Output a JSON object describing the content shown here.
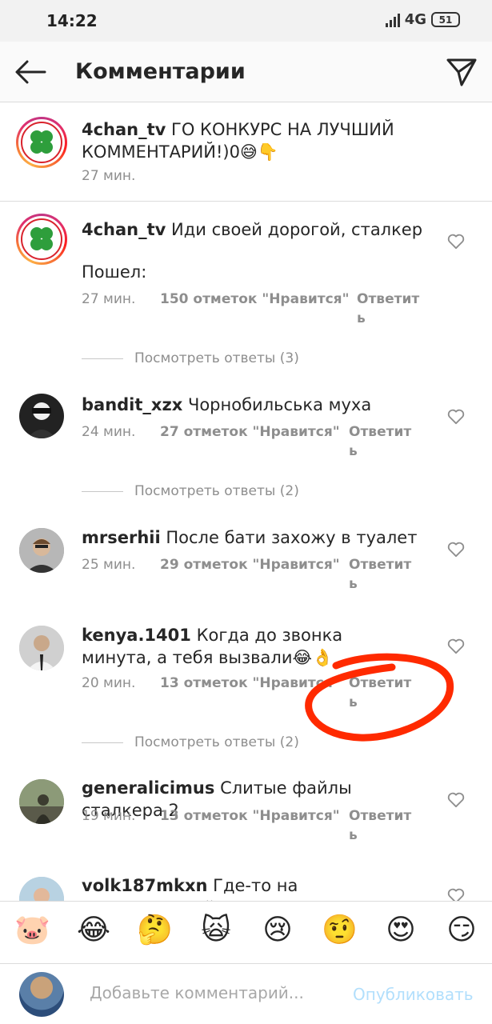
{
  "status_bar": {
    "time": "14:22",
    "network": "4G",
    "battery": "51"
  },
  "header": {
    "title": "Комментарии",
    "back_icon": "arrow-left-icon",
    "send_icon": "paper-plane-icon"
  },
  "caption": {
    "username": "4chan_tv",
    "text": "ГО КОНКУРС НА ЛУЧШИЙ КОММЕНТАРИЙ!)0😅👇",
    "time": "27 мин."
  },
  "comments": [
    {
      "username": "4chan_tv",
      "text": "Иди своей дорогой, сталкер",
      "extra": "Пошел:",
      "time": "27 мин.",
      "likes": "150 отметок \"Нравится\"",
      "reply": "Ответить",
      "view_replies": "Посмотреть ответы (3)"
    },
    {
      "username": "bandit_xzx",
      "text": "Чорнобильська муха",
      "time": "24 мин.",
      "likes": "27 отметок \"Нравится\"",
      "reply": "Ответить",
      "view_replies": "Посмотреть ответы (2)"
    },
    {
      "username": "mrserhii",
      "text": "После бати захожу в туалет",
      "time": "25 мин.",
      "likes": "29 отметок \"Нравится\"",
      "reply": "Ответить"
    },
    {
      "username": "kenya.1401",
      "text": "Когда до звонка минута, а тебя вызвали😂👌",
      "time": "20 мин.",
      "likes": "13 отметок \"Нравится\"",
      "reply": "Ответить",
      "view_replies": "Посмотреть ответы (2)"
    },
    {
      "username": "generalicimus",
      "text": "Слитые файлы сталкера 2",
      "time": "19 мин.",
      "likes": "13 отметок \"Нравится\"",
      "reply": "Ответить"
    },
    {
      "username": "volk187mkxn",
      "text": "Где-то на засекреченной"
    }
  ],
  "emoji_bar": [
    "🐷",
    "😂",
    "🤔",
    "🙀",
    "😢",
    "🤨",
    "😍",
    "😏"
  ],
  "input": {
    "placeholder": "Добавьте комментарий...",
    "publish": "Опубликовать"
  },
  "colors": {
    "annotation": "#ff2a00",
    "link_disabled": "#b2dffc",
    "muted": "#8e8e8e"
  }
}
